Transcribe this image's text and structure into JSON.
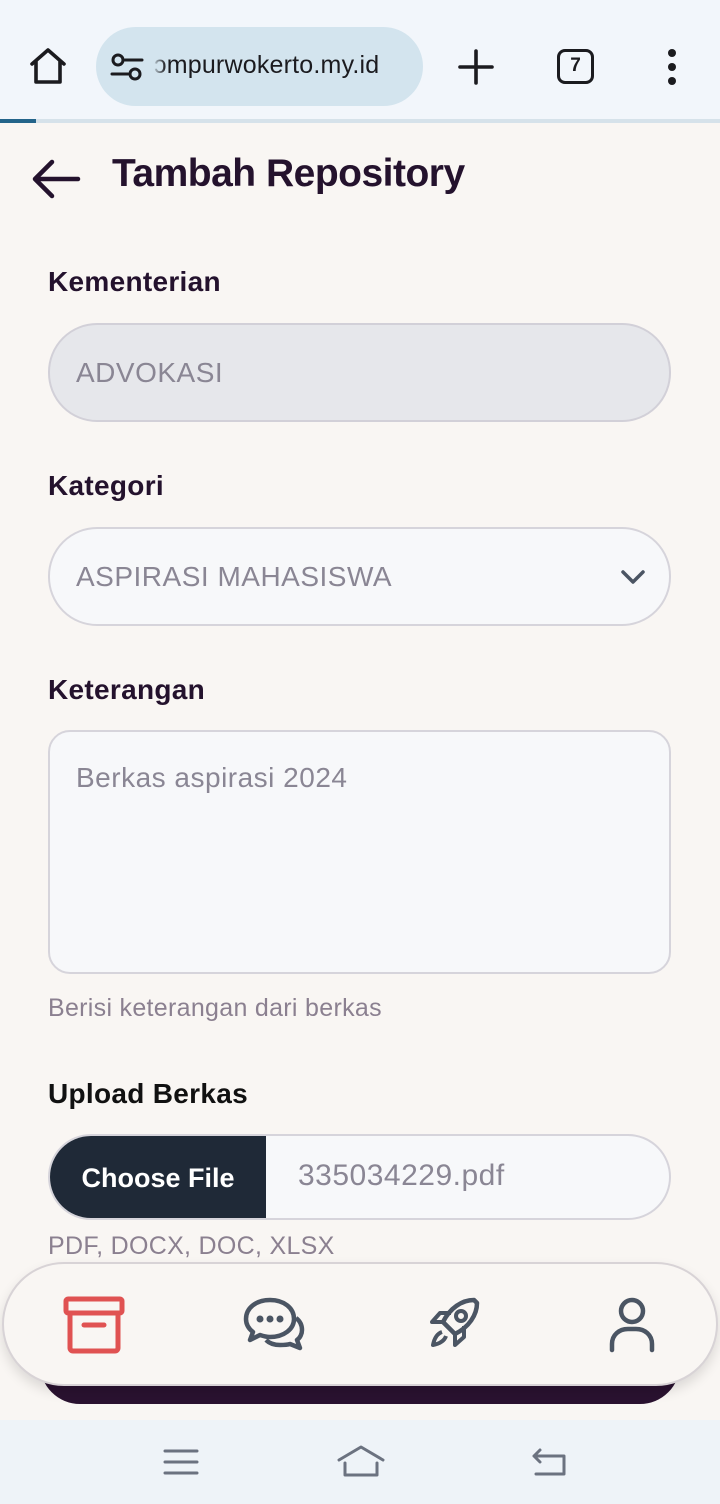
{
  "browser": {
    "url": "ɔmpurwokerto.my.id",
    "tab_count": "7",
    "load_progress": 0.05
  },
  "page": {
    "title": "Tambah Repository"
  },
  "form": {
    "kementerian": {
      "label": "Kementerian",
      "value": "ADVOKASI",
      "disabled": true
    },
    "kategori": {
      "label": "Kategori",
      "value": "ASPIRASI MAHASISWA"
    },
    "keterangan": {
      "label": "Keterangan",
      "value": "Berkas aspirasi 2024",
      "hint": "Berisi keterangan dari berkas"
    },
    "upload": {
      "label": "Upload Berkas",
      "button_label": "Choose File",
      "file_name": "335034229.pdf",
      "hint": "PDF, DOCX, DOC, XLSX"
    }
  },
  "bottom_nav": {
    "items": [
      {
        "icon": "archive-icon",
        "active": true
      },
      {
        "icon": "chat-bubbles-icon",
        "active": false
      },
      {
        "icon": "rocket-icon",
        "active": false
      },
      {
        "icon": "user-icon",
        "active": false
      }
    ]
  },
  "colors": {
    "accent_active": "#e05252",
    "title": "#24122d",
    "button_dark": "#1f2937"
  }
}
